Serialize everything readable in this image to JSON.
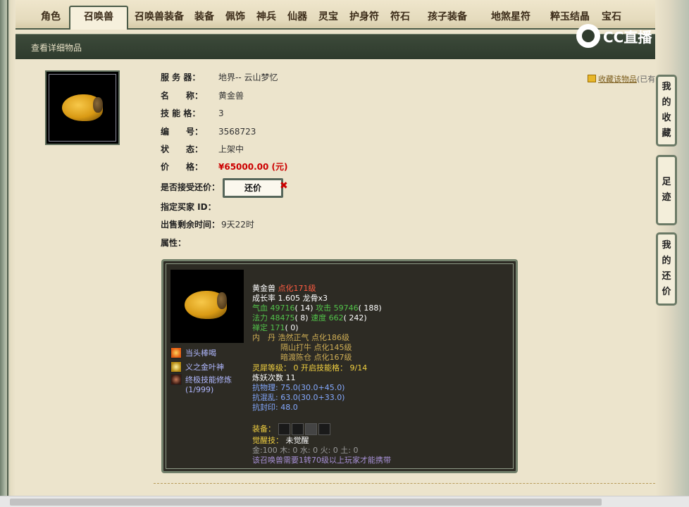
{
  "tabs": [
    {
      "label": "角色"
    },
    {
      "label": "召唤兽"
    },
    {
      "label": "召唤兽装备"
    },
    {
      "label": "装备"
    },
    {
      "label": "佩饰"
    },
    {
      "label": "神兵"
    },
    {
      "label": "仙器"
    },
    {
      "label": "灵宝"
    },
    {
      "label": "护身符"
    },
    {
      "label": "符石"
    },
    {
      "label": "孩子装备"
    },
    {
      "label": "地煞星符"
    },
    {
      "label": "粹玉结晶"
    },
    {
      "label": "宝石"
    }
  ],
  "subbar": {
    "title": "查看详细物品"
  },
  "watermark": {
    "text": "CC直播"
  },
  "favorite": {
    "label": "收藏该物品",
    "suffix": "(已有"
  },
  "info": {
    "server_label": "服 务 器：",
    "server_value": "地界-- 云山梦忆",
    "name_label": "名　　称：",
    "name_value": "黄金兽",
    "skill_slots_label": "技 能 格：",
    "skill_slots_value": "3",
    "id_label": "编　　号：",
    "id_value": "3568723",
    "status_label": "状　　态：",
    "status_value": "上架中",
    "price_label": "价　　格：",
    "price_value": "¥65000.00 (元)",
    "bargain_label": "是否接受还价：",
    "bargain_button": "还价",
    "bargain_x": "✖",
    "buyer_label": "指定买家 ID：",
    "remaining_label": "出售剩余时间：",
    "remaining_value": "9天22时",
    "attrs_label": "属性："
  },
  "side_tabs": [
    {
      "chars": [
        "我",
        "的",
        "收",
        "藏"
      ]
    },
    {
      "chars": [
        "足",
        "迹"
      ]
    },
    {
      "chars": [
        "我",
        "的",
        "还",
        "价"
      ]
    }
  ],
  "pet": {
    "skills": [
      {
        "label": "当头棒喝",
        "icon": "fire-skill-icon"
      },
      {
        "label": "义之金叶神",
        "icon": "gold-leaf-skill-icon"
      },
      {
        "label": "终极技能修炼",
        "sub": "(1/999)",
        "icon": "training-skill-icon"
      }
    ],
    "name": "黄金兽",
    "refine": "点化171级",
    "growth_label": "成长率",
    "growth_value": "1.605",
    "bone": "龙骨x3",
    "hp_label": "气血",
    "hp_value": "49716",
    "hp_extra": "( 14)",
    "atk_label": "攻击",
    "atk_value": "59746",
    "atk_extra": "( 188)",
    "mp_label": "法力",
    "mp_value": "48475",
    "mp_extra": "( 8)",
    "spd_label": "速度",
    "spd_value": "662",
    "spd_extra": "( 242)",
    "zen_label": "禅定",
    "zen_value": "171",
    "zen_extra": "( 0)",
    "neidan_label": "内　丹",
    "neidan": [
      "浩然正气 点化186级",
      "隔山打牛 点化145级",
      "暗渡陈仓 点化167级"
    ],
    "spirit_label": "灵犀等级：",
    "spirit_value": "0",
    "spirit_open_label": "开启技能格：",
    "spirit_open_value": "9/14",
    "demon_label": "炼妖次数",
    "demon_value": "11",
    "res_phys": "抗物理: 75.0(30.0+45.0)",
    "res_chaos": "抗混乱: 63.0(30.0+33.0)",
    "res_seal": "抗封印: 48.0",
    "equip_label": "装备：",
    "awaken_label": "觉醒技：",
    "awaken_value": "未觉醒",
    "elements": "金:100 木: 0 水: 0 火: 0 土: 0",
    "requirement": "该召唤兽需要1转70级以上玩家才能携带"
  }
}
